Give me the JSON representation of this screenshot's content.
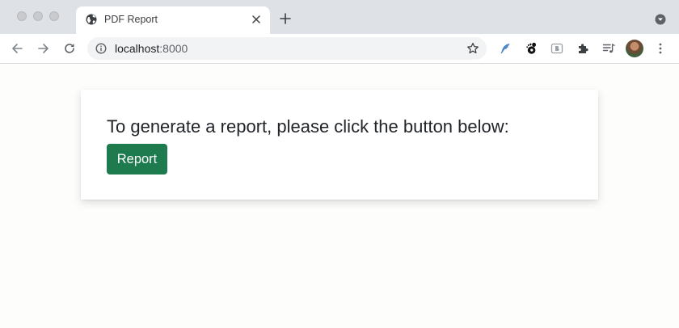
{
  "browser": {
    "tab": {
      "title": "PDF Report"
    },
    "address_bar": {
      "host": "localhost",
      "port": ":8000"
    }
  },
  "page": {
    "heading": "To generate a report, please click the button below:",
    "report_button_label": "Report",
    "button_color": "#1e7b4e"
  },
  "icons": {
    "tab": [
      "globe-icon",
      "close-icon",
      "new-tab-icon",
      "tab-search-icon"
    ],
    "toolbar": [
      "back-arrow-icon",
      "forward-arrow-icon",
      "reload-icon",
      "info-icon",
      "star-icon",
      "feather-extension-icon",
      "gnome-extension-icon",
      "b-extension-icon",
      "puzzle-extensions-icon",
      "media-queue-icon",
      "avatar",
      "more-menu-icon"
    ]
  }
}
